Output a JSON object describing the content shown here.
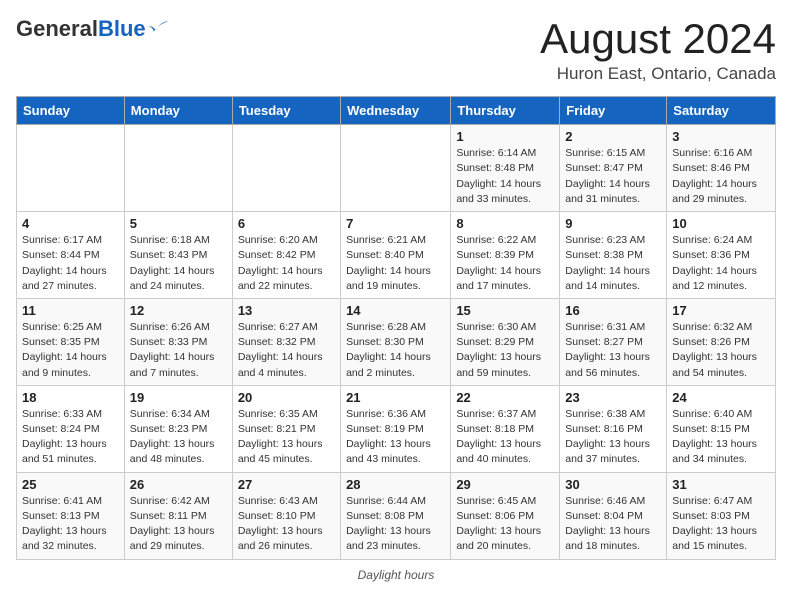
{
  "header": {
    "logo_general": "General",
    "logo_blue": "Blue",
    "month_title": "August 2024",
    "location": "Huron East, Ontario, Canada"
  },
  "days_of_week": [
    "Sunday",
    "Monday",
    "Tuesday",
    "Wednesday",
    "Thursday",
    "Friday",
    "Saturday"
  ],
  "weeks": [
    [
      {
        "day": "",
        "info": ""
      },
      {
        "day": "",
        "info": ""
      },
      {
        "day": "",
        "info": ""
      },
      {
        "day": "",
        "info": ""
      },
      {
        "day": "1",
        "info": "Sunrise: 6:14 AM\nSunset: 8:48 PM\nDaylight: 14 hours and 33 minutes."
      },
      {
        "day": "2",
        "info": "Sunrise: 6:15 AM\nSunset: 8:47 PM\nDaylight: 14 hours and 31 minutes."
      },
      {
        "day": "3",
        "info": "Sunrise: 6:16 AM\nSunset: 8:46 PM\nDaylight: 14 hours and 29 minutes."
      }
    ],
    [
      {
        "day": "4",
        "info": "Sunrise: 6:17 AM\nSunset: 8:44 PM\nDaylight: 14 hours and 27 minutes."
      },
      {
        "day": "5",
        "info": "Sunrise: 6:18 AM\nSunset: 8:43 PM\nDaylight: 14 hours and 24 minutes."
      },
      {
        "day": "6",
        "info": "Sunrise: 6:20 AM\nSunset: 8:42 PM\nDaylight: 14 hours and 22 minutes."
      },
      {
        "day": "7",
        "info": "Sunrise: 6:21 AM\nSunset: 8:40 PM\nDaylight: 14 hours and 19 minutes."
      },
      {
        "day": "8",
        "info": "Sunrise: 6:22 AM\nSunset: 8:39 PM\nDaylight: 14 hours and 17 minutes."
      },
      {
        "day": "9",
        "info": "Sunrise: 6:23 AM\nSunset: 8:38 PM\nDaylight: 14 hours and 14 minutes."
      },
      {
        "day": "10",
        "info": "Sunrise: 6:24 AM\nSunset: 8:36 PM\nDaylight: 14 hours and 12 minutes."
      }
    ],
    [
      {
        "day": "11",
        "info": "Sunrise: 6:25 AM\nSunset: 8:35 PM\nDaylight: 14 hours and 9 minutes."
      },
      {
        "day": "12",
        "info": "Sunrise: 6:26 AM\nSunset: 8:33 PM\nDaylight: 14 hours and 7 minutes."
      },
      {
        "day": "13",
        "info": "Sunrise: 6:27 AM\nSunset: 8:32 PM\nDaylight: 14 hours and 4 minutes."
      },
      {
        "day": "14",
        "info": "Sunrise: 6:28 AM\nSunset: 8:30 PM\nDaylight: 14 hours and 2 minutes."
      },
      {
        "day": "15",
        "info": "Sunrise: 6:30 AM\nSunset: 8:29 PM\nDaylight: 13 hours and 59 minutes."
      },
      {
        "day": "16",
        "info": "Sunrise: 6:31 AM\nSunset: 8:27 PM\nDaylight: 13 hours and 56 minutes."
      },
      {
        "day": "17",
        "info": "Sunrise: 6:32 AM\nSunset: 8:26 PM\nDaylight: 13 hours and 54 minutes."
      }
    ],
    [
      {
        "day": "18",
        "info": "Sunrise: 6:33 AM\nSunset: 8:24 PM\nDaylight: 13 hours and 51 minutes."
      },
      {
        "day": "19",
        "info": "Sunrise: 6:34 AM\nSunset: 8:23 PM\nDaylight: 13 hours and 48 minutes."
      },
      {
        "day": "20",
        "info": "Sunrise: 6:35 AM\nSunset: 8:21 PM\nDaylight: 13 hours and 45 minutes."
      },
      {
        "day": "21",
        "info": "Sunrise: 6:36 AM\nSunset: 8:19 PM\nDaylight: 13 hours and 43 minutes."
      },
      {
        "day": "22",
        "info": "Sunrise: 6:37 AM\nSunset: 8:18 PM\nDaylight: 13 hours and 40 minutes."
      },
      {
        "day": "23",
        "info": "Sunrise: 6:38 AM\nSunset: 8:16 PM\nDaylight: 13 hours and 37 minutes."
      },
      {
        "day": "24",
        "info": "Sunrise: 6:40 AM\nSunset: 8:15 PM\nDaylight: 13 hours and 34 minutes."
      }
    ],
    [
      {
        "day": "25",
        "info": "Sunrise: 6:41 AM\nSunset: 8:13 PM\nDaylight: 13 hours and 32 minutes."
      },
      {
        "day": "26",
        "info": "Sunrise: 6:42 AM\nSunset: 8:11 PM\nDaylight: 13 hours and 29 minutes."
      },
      {
        "day": "27",
        "info": "Sunrise: 6:43 AM\nSunset: 8:10 PM\nDaylight: 13 hours and 26 minutes."
      },
      {
        "day": "28",
        "info": "Sunrise: 6:44 AM\nSunset: 8:08 PM\nDaylight: 13 hours and 23 minutes."
      },
      {
        "day": "29",
        "info": "Sunrise: 6:45 AM\nSunset: 8:06 PM\nDaylight: 13 hours and 20 minutes."
      },
      {
        "day": "30",
        "info": "Sunrise: 6:46 AM\nSunset: 8:04 PM\nDaylight: 13 hours and 18 minutes."
      },
      {
        "day": "31",
        "info": "Sunrise: 6:47 AM\nSunset: 8:03 PM\nDaylight: 13 hours and 15 minutes."
      }
    ]
  ],
  "footer": {
    "note": "Daylight hours"
  }
}
